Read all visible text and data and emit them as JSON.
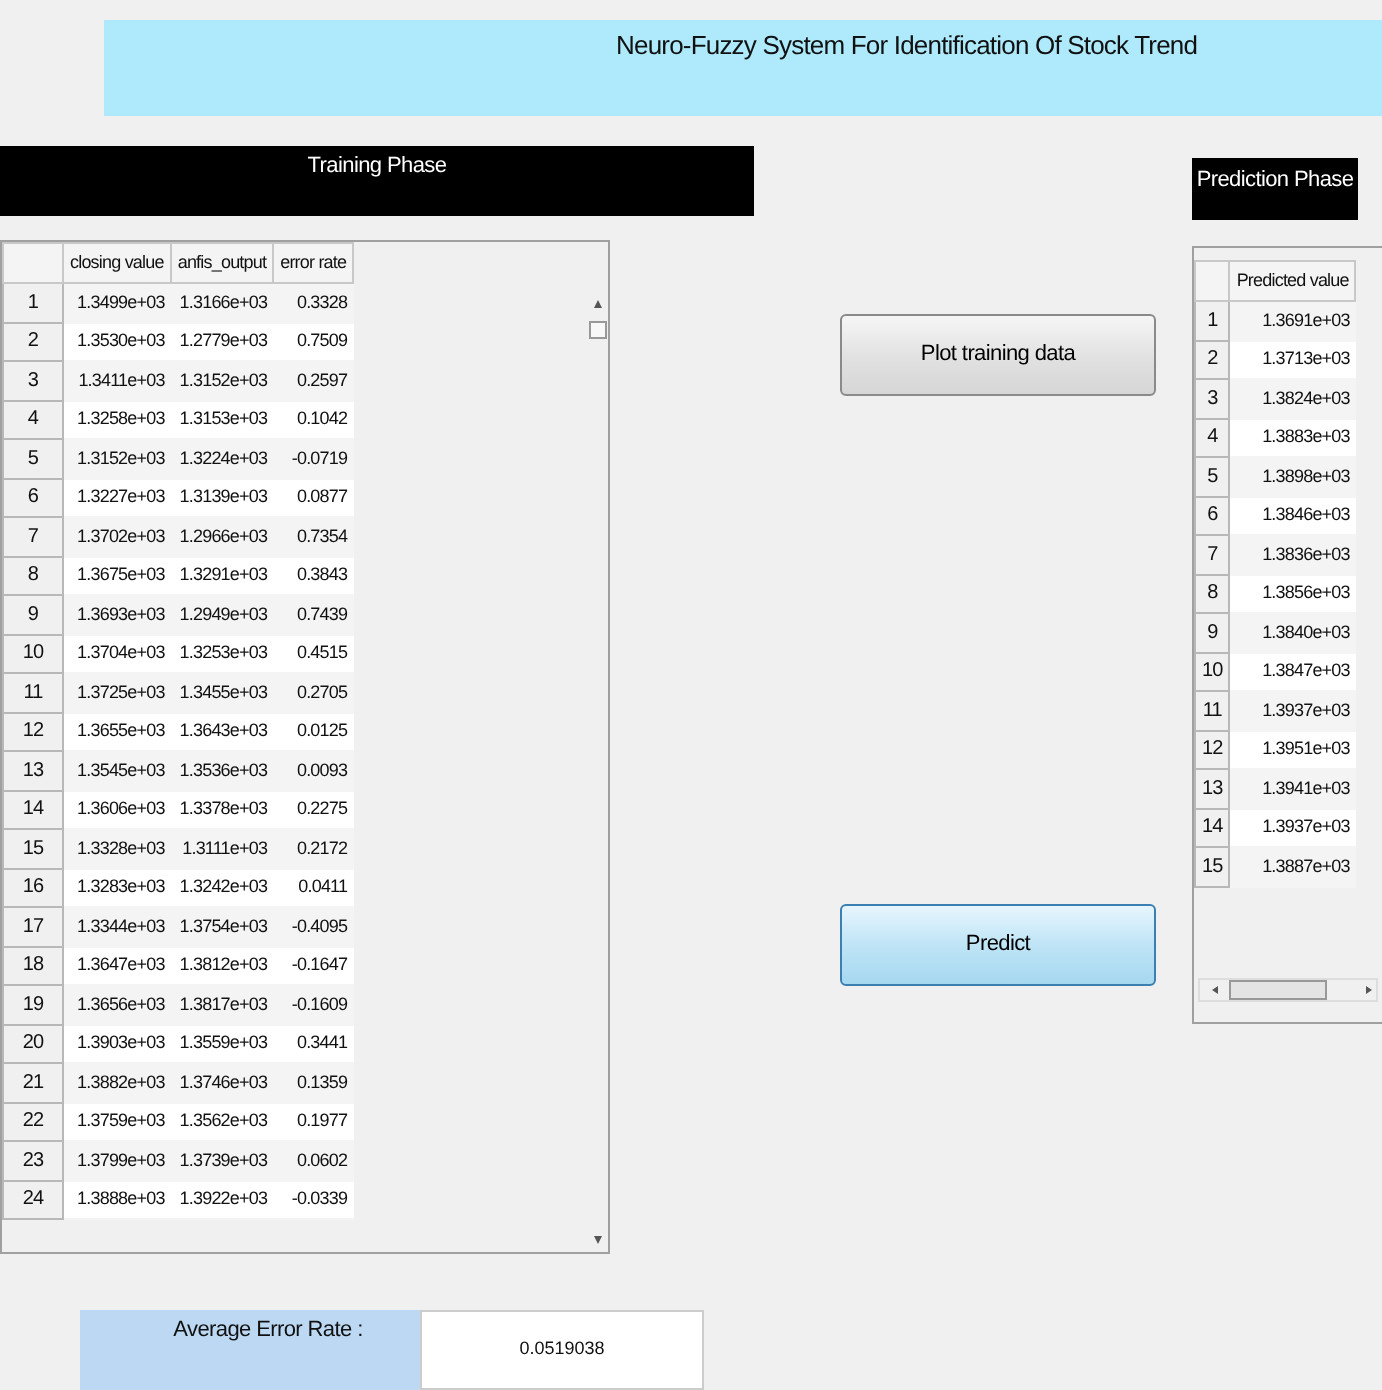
{
  "title": "Neuro-Fuzzy System For Identification Of Stock Trend",
  "training": {
    "heading": "Training Phase",
    "columns": [
      "closing value",
      "anfis_output",
      "error rate"
    ],
    "rows": [
      {
        "index": "1",
        "cells": [
          "1.3499e+03",
          "1.3166e+03",
          "0.3328"
        ]
      },
      {
        "index": "2",
        "cells": [
          "1.3530e+03",
          "1.2779e+03",
          "0.7509"
        ]
      },
      {
        "index": "3",
        "cells": [
          "1.3411e+03",
          "1.3152e+03",
          "0.2597"
        ]
      },
      {
        "index": "4",
        "cells": [
          "1.3258e+03",
          "1.3153e+03",
          "0.1042"
        ]
      },
      {
        "index": "5",
        "cells": [
          "1.3152e+03",
          "1.3224e+03",
          "-0.0719"
        ]
      },
      {
        "index": "6",
        "cells": [
          "1.3227e+03",
          "1.3139e+03",
          "0.0877"
        ]
      },
      {
        "index": "7",
        "cells": [
          "1.3702e+03",
          "1.2966e+03",
          "0.7354"
        ]
      },
      {
        "index": "8",
        "cells": [
          "1.3675e+03",
          "1.3291e+03",
          "0.3843"
        ]
      },
      {
        "index": "9",
        "cells": [
          "1.3693e+03",
          "1.2949e+03",
          "0.7439"
        ]
      },
      {
        "index": "10",
        "cells": [
          "1.3704e+03",
          "1.3253e+03",
          "0.4515"
        ]
      },
      {
        "index": "11",
        "cells": [
          "1.3725e+03",
          "1.3455e+03",
          "0.2705"
        ]
      },
      {
        "index": "12",
        "cells": [
          "1.3655e+03",
          "1.3643e+03",
          "0.0125"
        ]
      },
      {
        "index": "13",
        "cells": [
          "1.3545e+03",
          "1.3536e+03",
          "0.0093"
        ]
      },
      {
        "index": "14",
        "cells": [
          "1.3606e+03",
          "1.3378e+03",
          "0.2275"
        ]
      },
      {
        "index": "15",
        "cells": [
          "1.3328e+03",
          "1.3111e+03",
          "0.2172"
        ]
      },
      {
        "index": "16",
        "cells": [
          "1.3283e+03",
          "1.3242e+03",
          "0.0411"
        ]
      },
      {
        "index": "17",
        "cells": [
          "1.3344e+03",
          "1.3754e+03",
          "-0.4095"
        ]
      },
      {
        "index": "18",
        "cells": [
          "1.3647e+03",
          "1.3812e+03",
          "-0.1647"
        ]
      },
      {
        "index": "19",
        "cells": [
          "1.3656e+03",
          "1.3817e+03",
          "-0.1609"
        ]
      },
      {
        "index": "20",
        "cells": [
          "1.3903e+03",
          "1.3559e+03",
          "0.3441"
        ]
      },
      {
        "index": "21",
        "cells": [
          "1.3882e+03",
          "1.3746e+03",
          "0.1359"
        ]
      },
      {
        "index": "22",
        "cells": [
          "1.3759e+03",
          "1.3562e+03",
          "0.1977"
        ]
      },
      {
        "index": "23",
        "cells": [
          "1.3799e+03",
          "1.3739e+03",
          "0.0602"
        ]
      },
      {
        "index": "24",
        "cells": [
          "1.3888e+03",
          "1.3922e+03",
          "-0.0339"
        ]
      }
    ]
  },
  "buttons": [
    {
      "label": "Plot training data",
      "kind": "plain"
    },
    {
      "label": "Predict",
      "kind": "primary"
    }
  ],
  "prediction": {
    "heading": "Prediction Phase",
    "columns": [
      "Predicted value"
    ],
    "rows": [
      {
        "index": "1",
        "cells": [
          "1.3691e+03"
        ]
      },
      {
        "index": "2",
        "cells": [
          "1.3713e+03"
        ]
      },
      {
        "index": "3",
        "cells": [
          "1.3824e+03"
        ]
      },
      {
        "index": "4",
        "cells": [
          "1.3883e+03"
        ]
      },
      {
        "index": "5",
        "cells": [
          "1.3898e+03"
        ]
      },
      {
        "index": "6",
        "cells": [
          "1.3846e+03"
        ]
      },
      {
        "index": "7",
        "cells": [
          "1.3836e+03"
        ]
      },
      {
        "index": "8",
        "cells": [
          "1.3856e+03"
        ]
      },
      {
        "index": "9",
        "cells": [
          "1.3840e+03"
        ]
      },
      {
        "index": "10",
        "cells": [
          "1.3847e+03"
        ]
      },
      {
        "index": "11",
        "cells": [
          "1.3937e+03"
        ]
      },
      {
        "index": "12",
        "cells": [
          "1.3951e+03"
        ]
      },
      {
        "index": "13",
        "cells": [
          "1.3941e+03"
        ]
      },
      {
        "index": "14",
        "cells": [
          "1.3937e+03"
        ]
      },
      {
        "index": "15",
        "cells": [
          "1.3887e+03"
        ]
      }
    ]
  },
  "average_error": {
    "label": "Average Error Rate :",
    "value": "0.0519038"
  }
}
